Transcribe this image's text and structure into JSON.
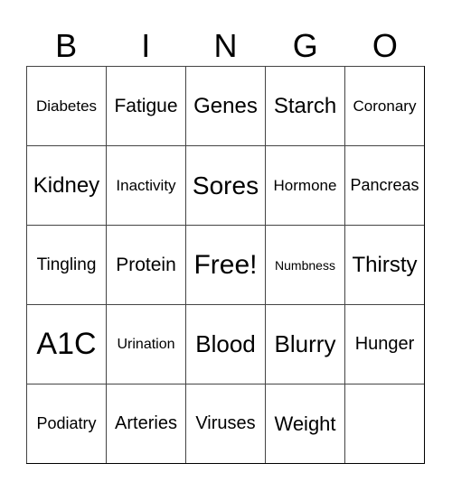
{
  "header": {
    "letters": [
      "B",
      "I",
      "N",
      "G",
      "O"
    ]
  },
  "card": {
    "rows": [
      [
        "Diabetes",
        "Fatigue",
        "Genes",
        "Starch",
        "Coronary"
      ],
      [
        "Kidney",
        "Inactivity",
        "Sores",
        "Hormone",
        "Pancreas"
      ],
      [
        "Tingling",
        "Protein",
        "Free!",
        "Numbness",
        "Thirsty"
      ],
      [
        "A1C",
        "Urination",
        "Blood",
        "Blurry",
        "Hunger"
      ],
      [
        "Podiatry",
        "Arteries",
        "Viruses",
        "Weight",
        ""
      ]
    ]
  }
}
